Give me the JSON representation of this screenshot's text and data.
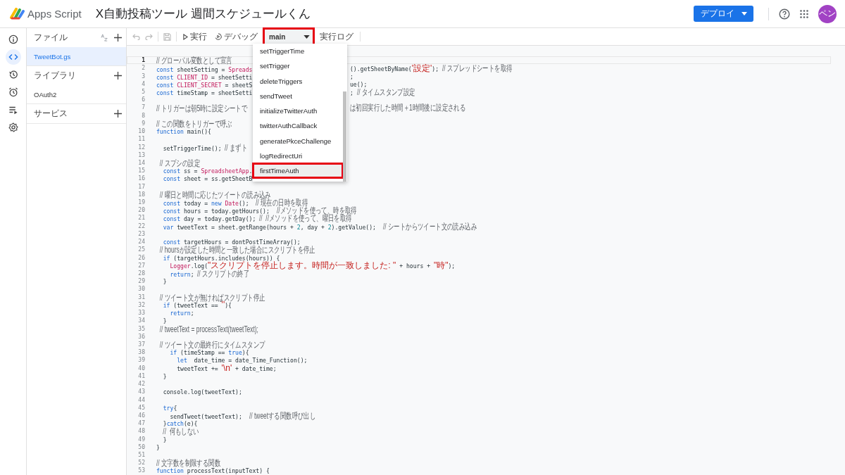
{
  "app": {
    "name": "Apps Script"
  },
  "project": {
    "title": "X自動投稿ツール 週間スケジュールくん"
  },
  "header": {
    "deploy_button": "デプロイ",
    "avatar": "ペン"
  },
  "rail": [
    {
      "kind": "info",
      "selected": false
    },
    {
      "kind": "editor",
      "selected": true
    },
    {
      "kind": "history",
      "selected": false
    },
    {
      "kind": "triggers",
      "selected": false
    },
    {
      "kind": "executions",
      "selected": false
    },
    {
      "kind": "settings",
      "selected": false
    }
  ],
  "files_panel": {
    "sections": [
      {
        "title": "ファイル",
        "sortable": true,
        "items": [
          {
            "label": "TweetBot.gs",
            "selected": true
          }
        ]
      },
      {
        "title": "ライブラリ",
        "sortable": false,
        "items": [
          {
            "label": "OAuth2",
            "selected": false
          }
        ]
      },
      {
        "title": "サービス",
        "sortable": false
      }
    ]
  },
  "toolbar": {
    "edit_actions": [
      {
        "kind": "undo",
        "disabled": true
      },
      {
        "kind": "redo",
        "disabled": true
      },
      {
        "kind": "save",
        "disabled": true
      }
    ],
    "run": "実行",
    "debug": "デバッグ",
    "function_select": {
      "value": "main",
      "highlighted": true
    },
    "log": "実行ログ"
  },
  "function_menu": {
    "items": [
      {
        "label": "setTriggerTime",
        "hovered": false,
        "highlighted": false
      },
      {
        "label": "setTrigger",
        "hovered": false,
        "highlighted": false
      },
      {
        "label": "deleteTriggers",
        "hovered": false,
        "highlighted": false
      },
      {
        "label": "sendTweet",
        "hovered": false,
        "highlighted": false
      },
      {
        "label": "initializeTwitterAuth",
        "hovered": false,
        "highlighted": false
      },
      {
        "label": "twitterAuthCallback",
        "hovered": false,
        "highlighted": false
      },
      {
        "label": "generatePkceChallenge",
        "hovered": false,
        "highlighted": false
      },
      {
        "label": "logRedirectUri",
        "hovered": false,
        "highlighted": false
      },
      {
        "label": "firstTimeAuth",
        "hovered": true,
        "highlighted": true
      }
    ]
  },
  "code": {
    "lines": [
      {
        "number": "1",
        "current": true,
        "tokens": [
          {
            "kind": "comment",
            "text": "// グローバル変数として宣言"
          }
        ]
      },
      {
        "number": "2",
        "current": false,
        "tokens": [
          {
            "kind": "keyword",
            "text": "const"
          },
          {
            "kind": "name",
            "text": " sheetSetting = "
          },
          {
            "kind": "global",
            "text": "Spreads"
          }
        ],
        "after_menu": [
          {
            "kind": "name",
            "text": "().getSheetByName("
          },
          {
            "kind": "string",
            "text": "'設定'"
          },
          {
            "kind": "name",
            "text": "); "
          },
          {
            "kind": "comment",
            "text": "// スプレッドシートを取得"
          }
        ]
      },
      {
        "number": "3",
        "current": false,
        "tokens": [
          {
            "kind": "keyword",
            "text": "const "
          },
          {
            "kind": "global",
            "text": "CLIENT_ID"
          },
          {
            "kind": "name",
            "text": " = sheetSetti"
          }
        ],
        "after_menu": [
          {
            "kind": "name",
            "text": ";"
          }
        ]
      },
      {
        "number": "4",
        "current": false,
        "tokens": [
          {
            "kind": "keyword",
            "text": "const "
          },
          {
            "kind": "global",
            "text": "CLIENT_SECRET"
          },
          {
            "kind": "name",
            "text": " = sheetS"
          }
        ],
        "after_menu": [
          {
            "kind": "name",
            "text": "ue();"
          }
        ]
      },
      {
        "number": "5",
        "current": false,
        "tokens": [
          {
            "kind": "keyword",
            "text": "const"
          },
          {
            "kind": "name",
            "text": " timeStamp = sheetSetti"
          }
        ],
        "after_menu": [
          {
            "kind": "name",
            "text": "; "
          },
          {
            "kind": "comment",
            "text": "// タイムスタンプ設定"
          }
        ]
      },
      {
        "number": "6",
        "current": false
      },
      {
        "number": "7",
        "current": false,
        "tokens": [
          {
            "kind": "comment",
            "text": "// トリガーは朝5時に設定シートで"
          }
        ],
        "after_menu": [
          {
            "kind": "comment",
            "text": "は初回実行した時間＋1時間後に設定される"
          }
        ]
      },
      {
        "number": "8",
        "current": false
      },
      {
        "number": "9",
        "current": false,
        "tokens": [
          {
            "kind": "comment",
            "text": "// この関数をトリガーで呼ぶ"
          }
        ]
      },
      {
        "number": "10",
        "current": false,
        "tokens": [
          {
            "kind": "keyword",
            "text": "function"
          },
          {
            "kind": "name",
            "text": " main(){"
          }
        ]
      },
      {
        "number": "11",
        "current": false
      },
      {
        "number": "12",
        "current": false,
        "tokens": [
          {
            "kind": "name",
            "text": "  setTriggerTime(); "
          },
          {
            "kind": "comment",
            "text": "// まずト"
          }
        ]
      },
      {
        "number": "13",
        "current": false
      },
      {
        "number": "14",
        "current": false,
        "tokens": [
          {
            "kind": "comment",
            "text": "  // スプシの設定"
          }
        ]
      },
      {
        "number": "15",
        "current": false,
        "tokens": [
          {
            "kind": "keyword",
            "text": "  const"
          },
          {
            "kind": "name",
            "text": " ss = "
          },
          {
            "kind": "global",
            "text": "SpreadsheetApp"
          },
          {
            "kind": "name",
            "text": "."
          }
        ]
      },
      {
        "number": "16",
        "current": false,
        "tokens": [
          {
            "kind": "keyword",
            "text": "  const"
          },
          {
            "kind": "name",
            "text": " sheet = ss.getSheetB"
          }
        ]
      },
      {
        "number": "17",
        "current": false
      },
      {
        "number": "18",
        "current": false,
        "tokens": [
          {
            "kind": "comment",
            "text": "  // 曜日と時間に応じたツイートの読み込み"
          }
        ]
      },
      {
        "number": "19",
        "current": false,
        "tokens": [
          {
            "kind": "keyword",
            "text": "  const"
          },
          {
            "kind": "name",
            "text": " today = "
          },
          {
            "kind": "keyword",
            "text": "new "
          },
          {
            "kind": "global",
            "text": "Date"
          },
          {
            "kind": "name",
            "text": "();  "
          },
          {
            "kind": "comment",
            "text": "// 現在の日時を取得"
          }
        ]
      },
      {
        "number": "20",
        "current": false,
        "tokens": [
          {
            "kind": "keyword",
            "text": "  const"
          },
          {
            "kind": "name",
            "text": " hours = today.getHours();  "
          },
          {
            "kind": "comment",
            "text": "//メソッドを使って、時を取得"
          }
        ]
      },
      {
        "number": "21",
        "current": false,
        "tokens": [
          {
            "kind": "keyword",
            "text": "  const"
          },
          {
            "kind": "name",
            "text": " day = today.getDay(); "
          },
          {
            "kind": "comment",
            "text": "//  //メソッドを使って、曜日を取得"
          }
        ]
      },
      {
        "number": "22",
        "current": false,
        "tokens": [
          {
            "kind": "keyword",
            "text": "  var"
          },
          {
            "kind": "name",
            "text": " tweetText = sheet.getRange(hours + "
          },
          {
            "kind": "number",
            "text": "2"
          },
          {
            "kind": "name",
            "text": ", day + "
          },
          {
            "kind": "number",
            "text": "2"
          },
          {
            "kind": "name",
            "text": ").getValue();  "
          },
          {
            "kind": "comment",
            "text": "// シートからツイート文の読み込み"
          }
        ]
      },
      {
        "number": "23",
        "current": false
      },
      {
        "number": "24",
        "current": false,
        "tokens": [
          {
            "kind": "keyword",
            "text": "  const"
          },
          {
            "kind": "name",
            "text": " targetHours = dontPostTimeArray();"
          }
        ]
      },
      {
        "number": "25",
        "current": false,
        "tokens": [
          {
            "kind": "comment",
            "text": "  // hoursが設定した時間と一致した場合にスクリプトを停止"
          }
        ]
      },
      {
        "number": "26",
        "current": false,
        "tokens": [
          {
            "kind": "keyword",
            "text": "  if"
          },
          {
            "kind": "name",
            "text": " (targetHours.includes(hours)) {"
          }
        ]
      },
      {
        "number": "27",
        "current": false,
        "tokens": [
          {
            "kind": "global",
            "text": "    Logger"
          },
          {
            "kind": "name",
            "text": ".log("
          },
          {
            "kind": "string",
            "text": "\"スクリプトを停止します。時間が一致しました: \""
          },
          {
            "kind": "name",
            "text": " + hours + "
          },
          {
            "kind": "string",
            "text": "\"時\""
          },
          {
            "kind": "name",
            "text": ");"
          }
        ]
      },
      {
        "number": "28",
        "current": false,
        "tokens": [
          {
            "kind": "keyword",
            "text": "    return"
          },
          {
            "kind": "name",
            "text": "; "
          },
          {
            "kind": "comment",
            "text": "// スクリプトの終了"
          }
        ]
      },
      {
        "number": "29",
        "current": false,
        "tokens": [
          {
            "kind": "name",
            "text": "  }"
          }
        ]
      },
      {
        "number": "30",
        "current": false
      },
      {
        "number": "31",
        "current": false,
        "tokens": [
          {
            "kind": "comment",
            "text": "  // ツイート文が無ければスクリプト停止"
          }
        ]
      },
      {
        "number": "32",
        "current": false,
        "tokens": [
          {
            "kind": "keyword",
            "text": "  if"
          },
          {
            "kind": "name",
            "text": " (tweetText == "
          },
          {
            "kind": "string",
            "text": "''"
          },
          {
            "kind": "name",
            "text": "){"
          }
        ]
      },
      {
        "number": "33",
        "current": false,
        "tokens": [
          {
            "kind": "keyword",
            "text": "    return"
          },
          {
            "kind": "name",
            "text": ";"
          }
        ]
      },
      {
        "number": "34",
        "current": false,
        "tokens": [
          {
            "kind": "name",
            "text": "  }"
          }
        ]
      },
      {
        "number": "35",
        "current": false,
        "tokens": [
          {
            "kind": "comment",
            "text": "  // tweetText = processText(tweetText);"
          }
        ]
      },
      {
        "number": "36",
        "current": false
      },
      {
        "number": "37",
        "current": false,
        "tokens": [
          {
            "kind": "comment",
            "text": "  // ツイート文の最終行にタイムスタンプ"
          }
        ]
      },
      {
        "number": "38",
        "current": false,
        "tokens": [
          {
            "kind": "keyword",
            "text": "    if"
          },
          {
            "kind": "name",
            "text": " (timeStamp == "
          },
          {
            "kind": "keyword",
            "text": "true"
          },
          {
            "kind": "name",
            "text": "){"
          }
        ]
      },
      {
        "number": "39",
        "current": false,
        "tokens": [
          {
            "kind": "keyword",
            "text": "      let"
          },
          {
            "kind": "name",
            "text": "  date_time = date_Time_Function();"
          }
        ]
      },
      {
        "number": "40",
        "current": false,
        "tokens": [
          {
            "kind": "name",
            "text": "      tweetText += "
          },
          {
            "kind": "string",
            "text": "'\\n'"
          },
          {
            "kind": "name",
            "text": " + date_time;"
          }
        ]
      },
      {
        "number": "41",
        "current": false,
        "tokens": [
          {
            "kind": "name",
            "text": "  }"
          }
        ]
      },
      {
        "number": "42",
        "current": false
      },
      {
        "number": "43",
        "current": false,
        "tokens": [
          {
            "kind": "name",
            "text": "  console.log(tweetText);"
          }
        ]
      },
      {
        "number": "44",
        "current": false
      },
      {
        "number": "45",
        "current": false,
        "tokens": [
          {
            "kind": "keyword",
            "text": "  try"
          },
          {
            "kind": "name",
            "text": "{"
          }
        ]
      },
      {
        "number": "46",
        "current": false,
        "tokens": [
          {
            "kind": "name",
            "text": "    sendTweet(tweetText);  "
          },
          {
            "kind": "comment",
            "text": "// tweetする関数呼び出し"
          }
        ]
      },
      {
        "number": "47",
        "current": false,
        "tokens": [
          {
            "kind": "name",
            "text": "  }"
          },
          {
            "kind": "keyword",
            "text": "catch"
          },
          {
            "kind": "name",
            "text": "(e){"
          }
        ]
      },
      {
        "number": "48",
        "current": false,
        "tokens": [
          {
            "kind": "comment",
            "text": "    //  何もしない"
          }
        ]
      },
      {
        "number": "49",
        "current": false,
        "tokens": [
          {
            "kind": "name",
            "text": "  }"
          }
        ]
      },
      {
        "number": "50",
        "current": false,
        "tokens": [
          {
            "kind": "name",
            "text": "}"
          }
        ]
      },
      {
        "number": "51",
        "current": false
      },
      {
        "number": "52",
        "current": false,
        "tokens": [
          {
            "kind": "comment",
            "text": "// 文字数を制限する関数"
          }
        ]
      },
      {
        "number": "53",
        "current": false,
        "tokens": [
          {
            "kind": "keyword",
            "text": "function"
          },
          {
            "kind": "name",
            "text": " processText(inputText) {"
          }
        ]
      }
    ]
  }
}
